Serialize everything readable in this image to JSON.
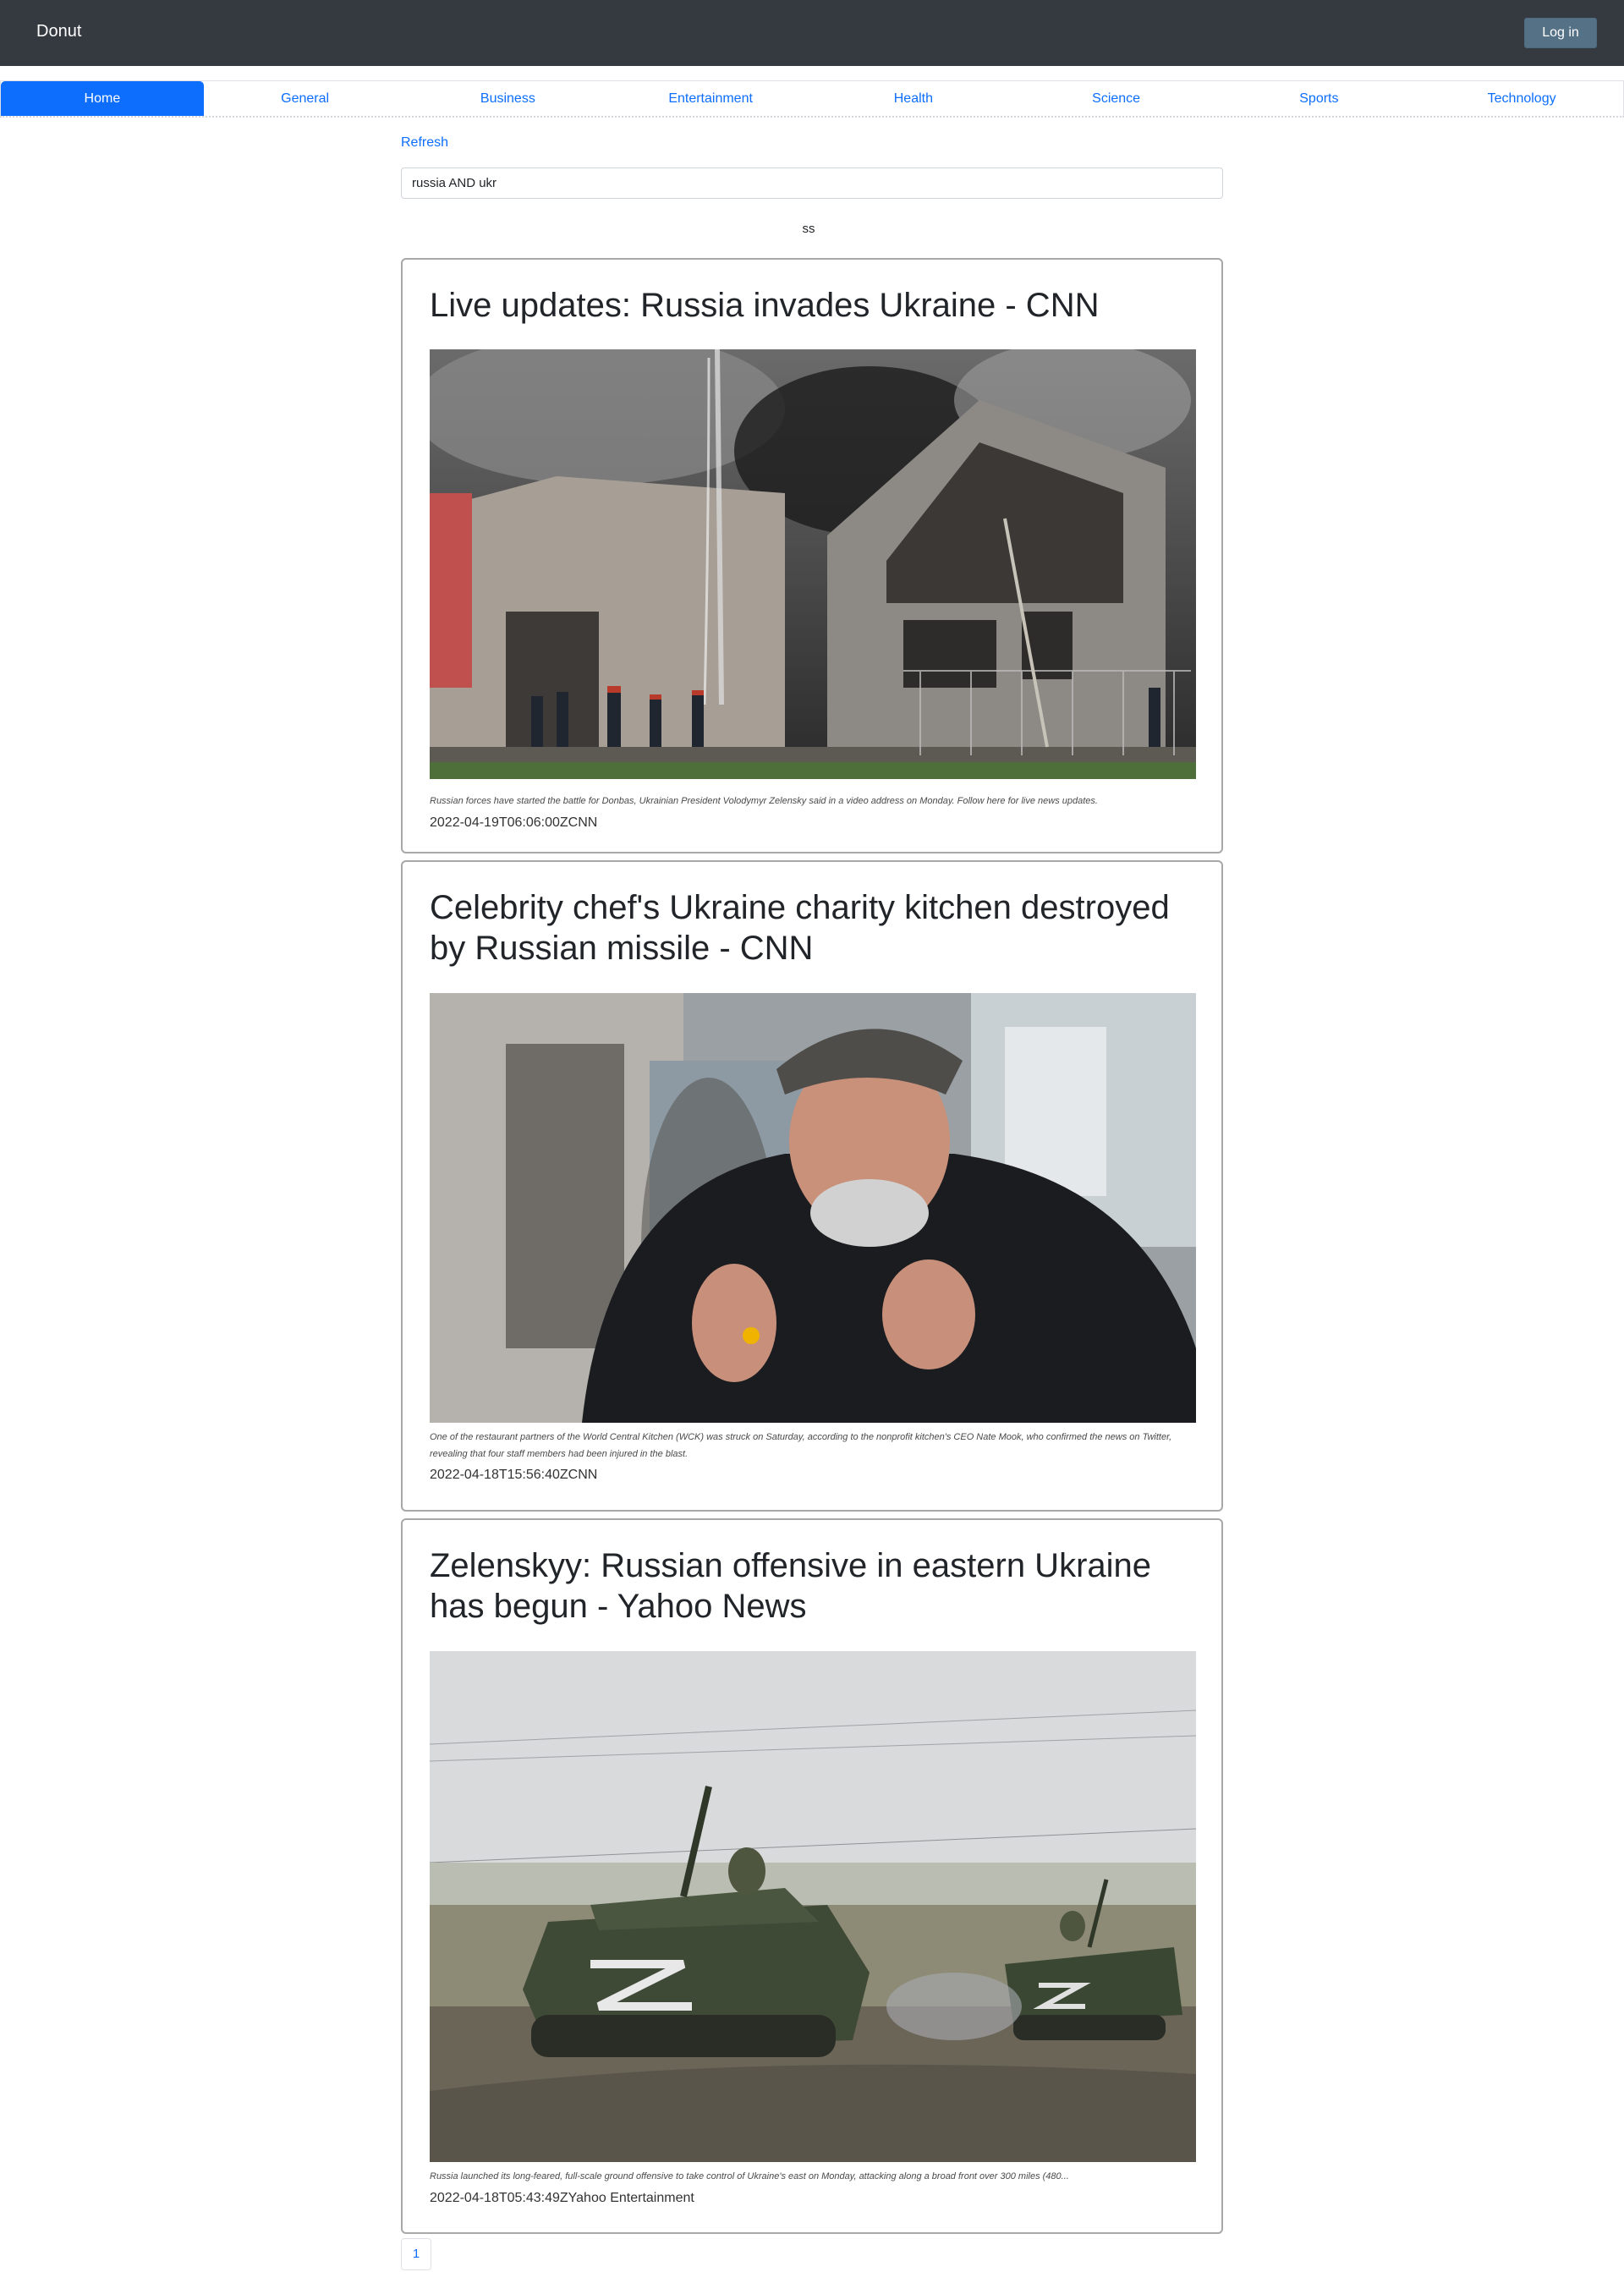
{
  "navbar": {
    "brand": "Donut",
    "login_label": "Log in"
  },
  "tabs": [
    {
      "label": "Home",
      "active": true
    },
    {
      "label": "General"
    },
    {
      "label": "Business"
    },
    {
      "label": "Entertainment"
    },
    {
      "label": "Health"
    },
    {
      "label": "Science"
    },
    {
      "label": "Sports"
    },
    {
      "label": "Technology"
    }
  ],
  "refresh_label": "Refresh",
  "search": {
    "value": "russia AND ukr"
  },
  "status_text": "ss",
  "articles": [
    {
      "title": "Live updates: Russia invades Ukraine - CNN",
      "image_alt": "Firefighters spraying water on a burning damaged building",
      "description": "Russian forces have started the battle for Donbas, Ukrainian President Volodymyr Zelensky said in a video address on Monday. Follow here for live news updates.",
      "meta": "2022-04-19T06:06:00ZCNN"
    },
    {
      "title": "Celebrity chef's Ukraine charity kitchen destroyed by Russian missile - CNN",
      "image_alt": "Man in a cap and black jacket gesturing while speaking",
      "description": "One of the restaurant partners of the World Central Kitchen (WCK) was struck on Saturday, according to the nonprofit kitchen's CEO Nate Mook, who confirmed the news on Twitter, revealing that four staff members had been injured in the blast.",
      "meta": "2022-04-18T15:56:40ZCNN"
    },
    {
      "title": "Zelenskyy: Russian offensive in eastern Ukraine has begun - Yahoo News",
      "image_alt": "Armored vehicles marked with Z driving on a dirt road",
      "description": "Russia launched its long-feared, full-scale ground offensive to take control of Ukraine's east on Monday, attacking along a broad front over 300 miles (480...",
      "meta": "2022-04-18T05:43:49ZYahoo Entertainment"
    }
  ],
  "pagination": {
    "current": "1"
  }
}
